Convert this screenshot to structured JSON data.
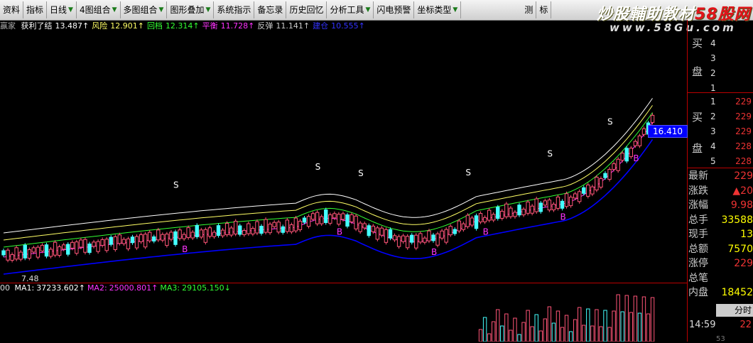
{
  "toolbar": {
    "items": [
      {
        "label": "资料",
        "arrow": false
      },
      {
        "label": "指标",
        "arrow": false
      },
      {
        "label": "日线",
        "arrow": true
      },
      {
        "label": "4图组合",
        "arrow": true
      },
      {
        "label": "多图组合",
        "arrow": true
      },
      {
        "label": "图形叠加",
        "arrow": true
      },
      {
        "label": "系统指示",
        "arrow": false
      },
      {
        "label": "备忘录",
        "arrow": false
      },
      {
        "label": "历史回忆",
        "arrow": false
      },
      {
        "label": "分析工具",
        "arrow": true
      },
      {
        "label": "闪电预警",
        "arrow": false
      },
      {
        "label": "坐标类型",
        "arrow": true
      }
    ],
    "right_items": [
      {
        "label": "测"
      },
      {
        "label": "标"
      }
    ]
  },
  "watermark": {
    "text_white": "炒股輔助教材",
    "text_red": "58股网",
    "url": "www.58Gu.com"
  },
  "indicator": {
    "name": "赢家",
    "items": [
      {
        "label": "获利了结",
        "value": "13.487↑",
        "color": "#ffffff"
      },
      {
        "label": "风险",
        "value": "12.901↑",
        "color": "#ffff66"
      },
      {
        "label": "回档",
        "value": "12.314↑",
        "color": "#33ff33"
      },
      {
        "label": "平衡",
        "value": "11.728↑",
        "color": "#ff33ff"
      },
      {
        "label": "反弹",
        "value": "11.141↑",
        "color": "#cccccc"
      },
      {
        "label": "建仓",
        "value": "10.555↑",
        "color": "#3333ff"
      }
    ]
  },
  "chart_data": {
    "type": "candlestick",
    "low_label": "7.48",
    "last_price_tag": "16.410",
    "markers": [
      {
        "text": "S",
        "i": 40
      },
      {
        "text": "S",
        "i": 73
      },
      {
        "text": "S",
        "i": 83
      },
      {
        "text": "S",
        "i": 108
      },
      {
        "text": "S",
        "i": 127
      },
      {
        "text": "S",
        "i": 141
      },
      {
        "text": "B",
        "i": 42
      },
      {
        "text": "B",
        "i": 78
      },
      {
        "text": "B",
        "i": 100
      },
      {
        "text": "B",
        "i": 112
      },
      {
        "text": "B",
        "i": 130
      },
      {
        "text": "B",
        "i": 147
      }
    ],
    "band_colors": [
      "#ffffff",
      "#ffff66",
      "#33ff33",
      "#ff33ff",
      "#0000ff"
    ]
  },
  "volume": {
    "prefix": "00",
    "items": [
      {
        "label": "MA1:",
        "value": "37233.602↑",
        "color": "#ffffff"
      },
      {
        "label": "MA2:",
        "value": "25000.801↑",
        "color": "#ff33ff"
      },
      {
        "label": "MA3:",
        "value": "29105.150↓",
        "color": "#33ff33"
      }
    ]
  },
  "orderbook": {
    "sell_label_top": "买",
    "sell_label_bottom": "盘",
    "sell_rows": [
      {
        "lvl": "4",
        "price": ""
      },
      {
        "lvl": "3",
        "price": ""
      },
      {
        "lvl": "2",
        "price": ""
      },
      {
        "lvl": "1",
        "price": ""
      }
    ],
    "buy_label_top": "买",
    "buy_label_bottom": "盘",
    "buy_rows": [
      {
        "lvl": "1",
        "price": "229"
      },
      {
        "lvl": "2",
        "price": "229"
      },
      {
        "lvl": "3",
        "price": "229"
      },
      {
        "lvl": "4",
        "price": "228"
      },
      {
        "lvl": "5",
        "price": "228"
      }
    ]
  },
  "quote": [
    {
      "label": "最新",
      "value": "229",
      "cls": ""
    },
    {
      "label": "涨跌",
      "value": "▲20",
      "cls": ""
    },
    {
      "label": "涨幅",
      "value": "9.98",
      "cls": ""
    },
    {
      "label": "总手",
      "value": "33588",
      "cls": "y"
    },
    {
      "label": "现手",
      "value": "13",
      "cls": "y"
    },
    {
      "label": "总额",
      "value": "7570",
      "cls": "y"
    },
    {
      "label": "涨停",
      "value": "229",
      "cls": ""
    },
    {
      "label": "总笔",
      "value": "",
      "cls": ""
    },
    {
      "label": "内盘",
      "value": "18452",
      "cls": "y"
    }
  ],
  "tabs": {
    "time_tab": "分时"
  },
  "tick": {
    "time": "14:59",
    "price": "22",
    "vol": "53"
  }
}
